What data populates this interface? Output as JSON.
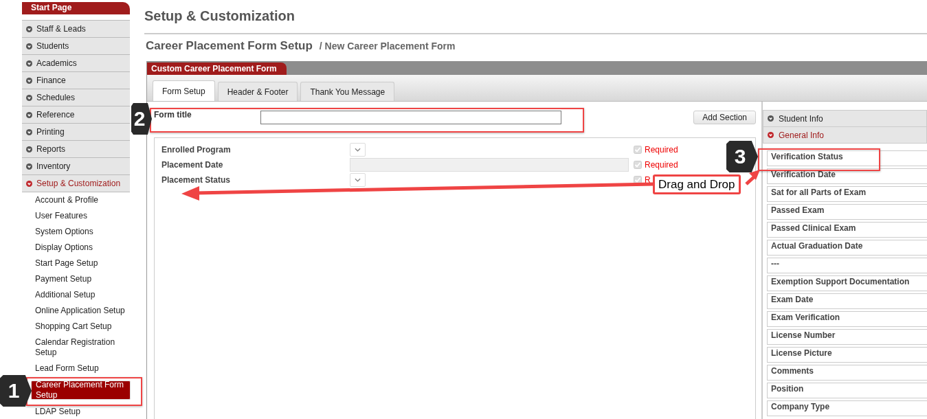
{
  "sidebar": {
    "header": "Start Page",
    "items": [
      {
        "label": "Staff & Leads",
        "expanded": false
      },
      {
        "label": "Students",
        "expanded": false
      },
      {
        "label": "Academics",
        "expanded": false
      },
      {
        "label": "Finance",
        "expanded": false
      },
      {
        "label": "Schedules",
        "expanded": false
      },
      {
        "label": "Reference",
        "expanded": false
      },
      {
        "label": "Printing",
        "expanded": false
      },
      {
        "label": "Reports",
        "expanded": false
      },
      {
        "label": "Inventory",
        "expanded": false
      },
      {
        "label": "Setup & Customization",
        "expanded": true,
        "children": [
          {
            "label": "Account & Profile",
            "selected": false
          },
          {
            "label": "User Features",
            "selected": false
          },
          {
            "label": "System Options",
            "selected": false
          },
          {
            "label": "Display Options",
            "selected": false
          },
          {
            "label": "Start Page Setup",
            "selected": false
          },
          {
            "label": "Payment Setup",
            "selected": false
          },
          {
            "label": "Additional Setup",
            "selected": false
          },
          {
            "label": "Online Application Setup",
            "selected": false
          },
          {
            "label": "Shopping Cart Setup",
            "selected": false
          },
          {
            "label": "Calendar Registration Setup",
            "selected": false
          },
          {
            "label": "Lead Form Setup",
            "selected": false
          },
          {
            "label": "Career Placement Form Setup",
            "selected": true
          },
          {
            "label": "LDAP Setup",
            "selected": false
          }
        ]
      }
    ]
  },
  "page": {
    "title": "Setup & Customization",
    "subtitle": "Career Placement Form Setup",
    "breadcrumb": "/ New Career Placement Form"
  },
  "panel": {
    "title": "Custom Career Placement Form",
    "tabs": [
      {
        "label": "Form Setup",
        "selected": true
      },
      {
        "label": "Header & Footer",
        "selected": false
      },
      {
        "label": "Thank You Message",
        "selected": false
      }
    ],
    "form_title": {
      "label": "Form title"
    },
    "add_section": "Add Section",
    "fields": [
      {
        "label": "Enrolled Program",
        "kind": "select",
        "required": true,
        "required_label": "Required"
      },
      {
        "label": "Placement Date",
        "kind": "text",
        "required": true,
        "required_label": "Required"
      },
      {
        "label": "Placement Status",
        "kind": "select",
        "required": true,
        "required_label": "R"
      }
    ],
    "sections": [
      {
        "label": "Student Info",
        "expanded": false
      },
      {
        "label": "General Info",
        "expanded": true
      }
    ],
    "available_fields": [
      "Verification Status",
      "Verification Date",
      "Sat for all Parts of Exam",
      "Passed Exam",
      "Passed Clinical Exam",
      "Actual Graduation Date",
      "---",
      "Exemption Support Documentation",
      "Exam Date",
      "Exam Verification",
      "License Number",
      "License Picture",
      "Comments",
      "Position",
      "Company Type"
    ]
  },
  "annotations": {
    "steps": [
      "1",
      "2",
      "3"
    ],
    "drag_label": "Drag and Drop"
  }
}
